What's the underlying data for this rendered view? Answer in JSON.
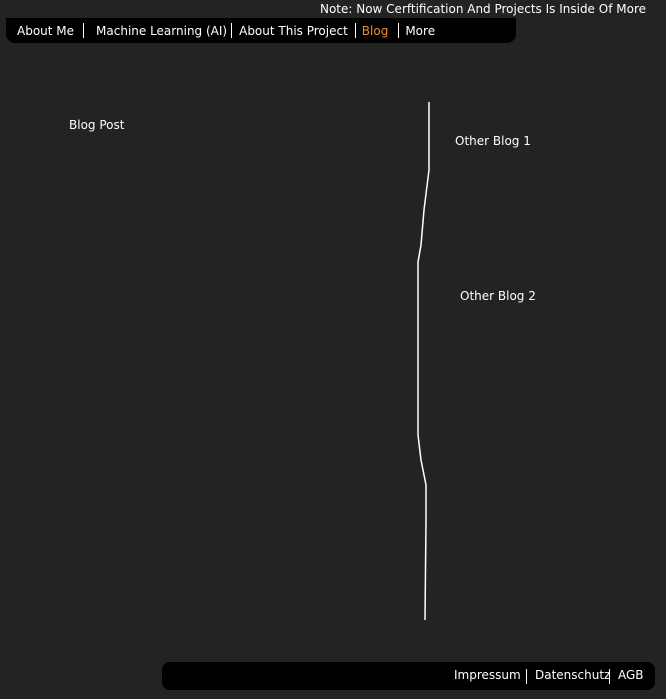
{
  "notice": "Note: Now Cerftification And Projects Is Inside Of More",
  "nav": {
    "about_me": "About Me",
    "machine_learning": "Machine Learning (AI)",
    "about_project": "About This Project",
    "blog": "Blog",
    "more": "More"
  },
  "content": {
    "blog_post": "Blog Post",
    "other_blog_1": "Other Blog 1",
    "other_blog_2": "Other Blog 2"
  },
  "footer": {
    "impressum": "Impressum",
    "datenschutz": "Datenschutz",
    "agb": "AGB"
  },
  "colors": {
    "background": "#232323",
    "bar": "#000000",
    "text": "#ffffff",
    "active": "#f08a2c"
  }
}
